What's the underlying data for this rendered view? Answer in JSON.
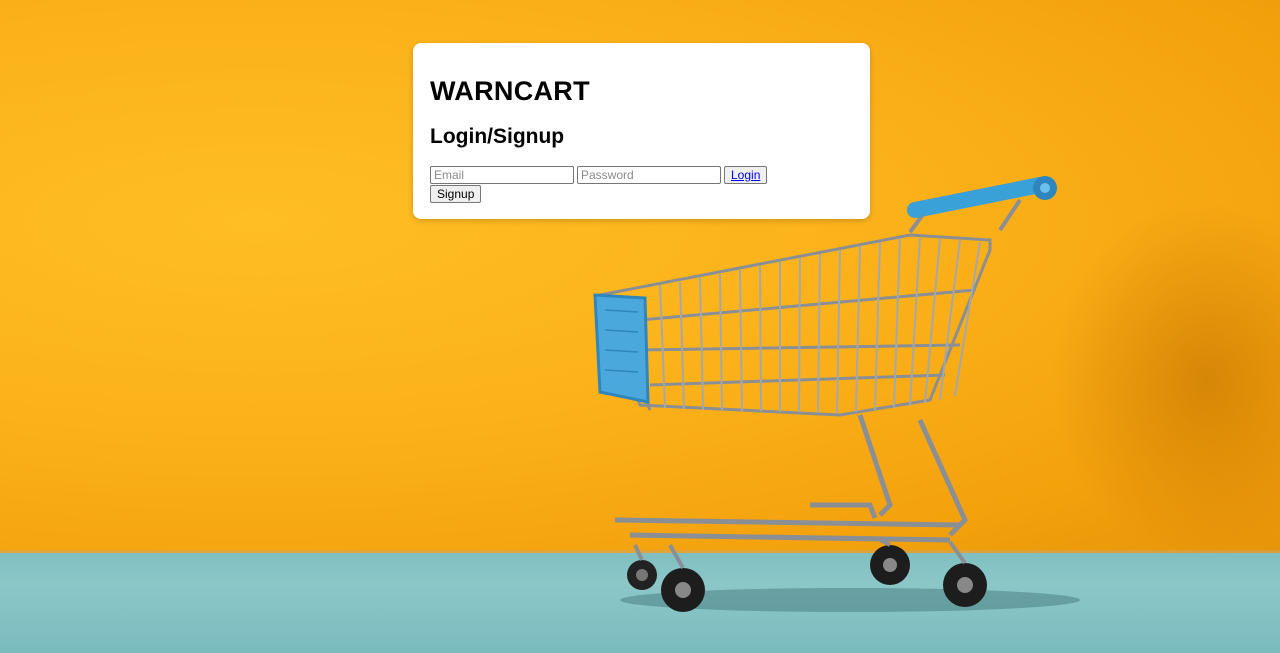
{
  "app": {
    "brand": "WARNCART",
    "subtitle": "Login/Signup"
  },
  "form": {
    "email_placeholder": "Email",
    "email_value": "",
    "password_placeholder": "Password",
    "password_value": "",
    "login_label": "Login",
    "signup_label": "Signup"
  },
  "background": {
    "wall_color": "#fbb11a",
    "floor_color": "#86c2c3",
    "cart_accent_color": "#3aa0d8"
  },
  "icons": {
    "hero_image": "shopping-cart-illustration"
  }
}
